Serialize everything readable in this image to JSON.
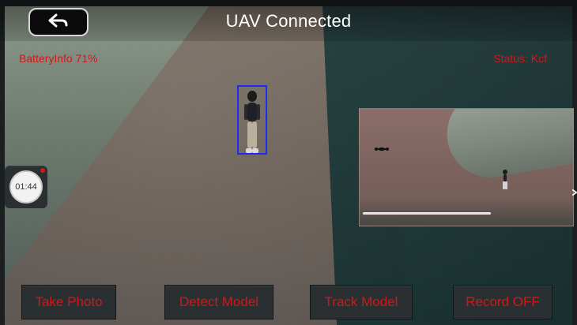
{
  "header": {
    "title": "UAV Connected"
  },
  "overlay": {
    "battery_text": "BatteryInfo 71%",
    "status_text": "Status: Kcf"
  },
  "timer": {
    "value": "01:44"
  },
  "pip": {
    "progress": 0.62
  },
  "buttons": {
    "take_photo": "Take Photo",
    "detect_model": "Detect Model",
    "track_model": "Track Model",
    "record": "Record OFF"
  },
  "colors": {
    "accent_red": "#d11818",
    "detection_blue": "#1c2df0"
  },
  "icons": {
    "back": "back-arrow-icon",
    "record": "record-dot-icon",
    "edge": "chevron-right-icon"
  }
}
